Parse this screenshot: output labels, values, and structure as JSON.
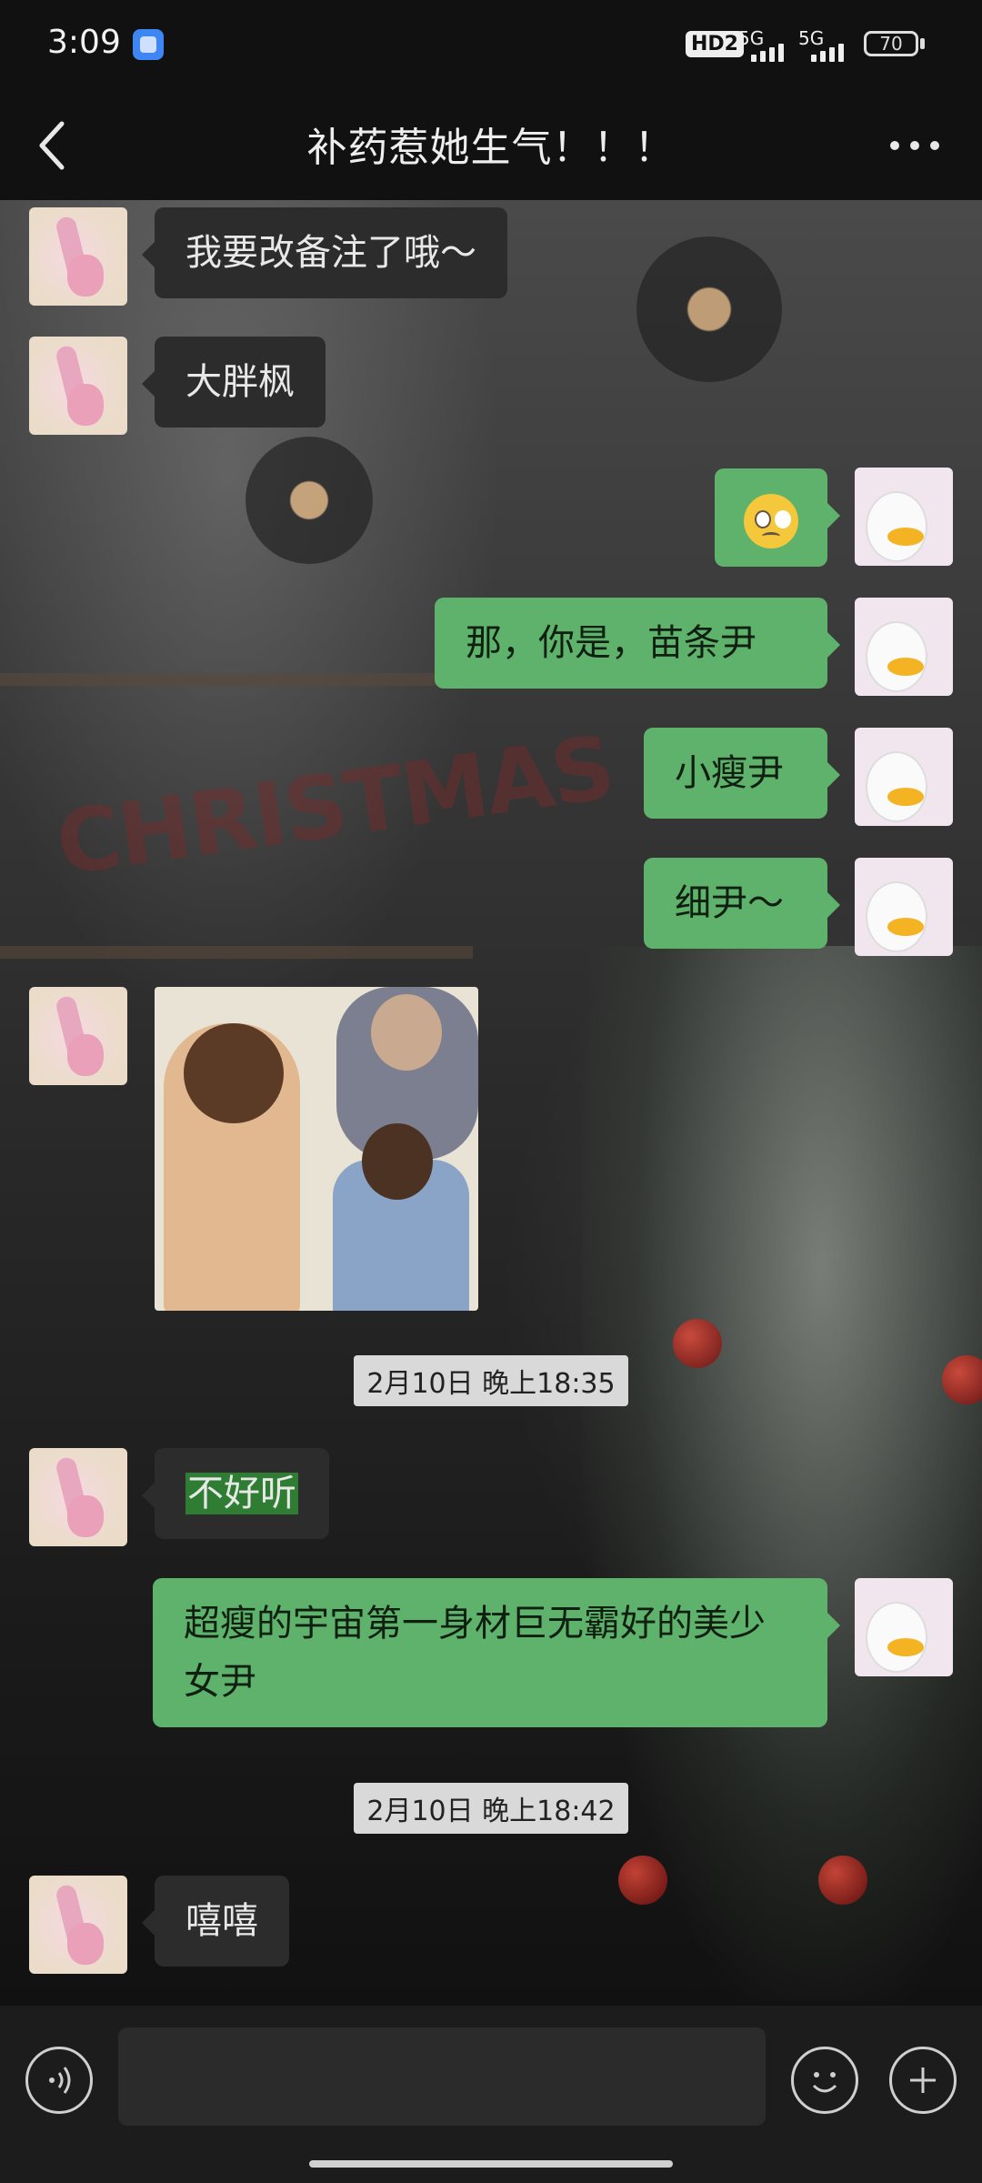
{
  "status_bar": {
    "time": "3:09",
    "hd_badge": "HD2",
    "signal_1": "5G",
    "signal_2": "5G",
    "battery": "70"
  },
  "header": {
    "title": "补药惹她生气！！！",
    "back_icon": "chevron-left-icon",
    "more_icon": "more-horizontal-icon"
  },
  "messages": [
    {
      "side": "left",
      "text": "我要改备注了哦～"
    },
    {
      "side": "left",
      "text": "大胖枫"
    },
    {
      "side": "right",
      "kind": "emoji",
      "emoji": "woozy-face"
    },
    {
      "side": "right",
      "text": "那，你是，苗条尹"
    },
    {
      "side": "right",
      "text": "小瘦尹"
    },
    {
      "side": "right",
      "text": "细尹～"
    },
    {
      "side": "left",
      "kind": "image",
      "image": "meme-covering-ears"
    },
    {
      "kind": "timestamp",
      "text": "2月10日 晚上18:35"
    },
    {
      "side": "left",
      "text": "不好听"
    },
    {
      "side": "right",
      "text": "超瘦的宇宙第一身材巨无霸好的美少女尹"
    },
    {
      "kind": "timestamp",
      "text": "2月10日 晚上18:42"
    },
    {
      "side": "left",
      "text": "嘻嘻"
    }
  ],
  "input_bar": {
    "voice_icon": "voice-icon",
    "emoji_icon": "smile-icon",
    "plus_icon": "plus-icon",
    "input_value": ""
  },
  "colors": {
    "sent_bubble": "#5fb26c",
    "received_bubble": "#2c2c2c",
    "header_bg": "#111111"
  }
}
